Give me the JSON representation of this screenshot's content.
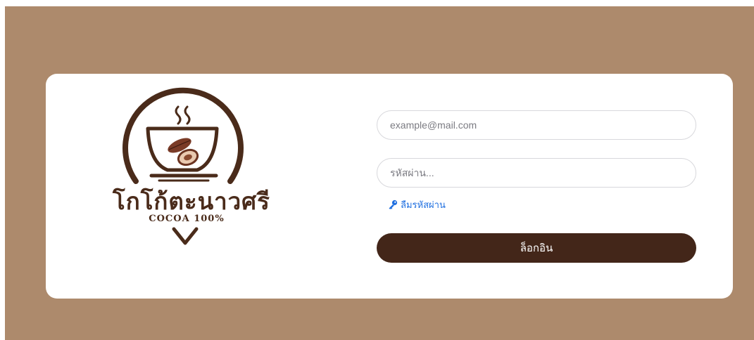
{
  "brand": {
    "name_thai": "โกโก้ตะนาวศรี",
    "tagline": "COCOA 100%",
    "colors": {
      "primary": "#432619",
      "logo": "#4a2b1a",
      "background": "#ad8a6c",
      "link": "#1f6fe0"
    }
  },
  "login_form": {
    "email_placeholder": "example@mail.com",
    "email_value": "",
    "password_placeholder": "รหัสผ่าน...",
    "password_value": "",
    "forgot_password_label": "ลืมรหัสผ่าน",
    "forgot_password_icon": "key-icon",
    "login_button_label": "ล็อกอิน"
  }
}
